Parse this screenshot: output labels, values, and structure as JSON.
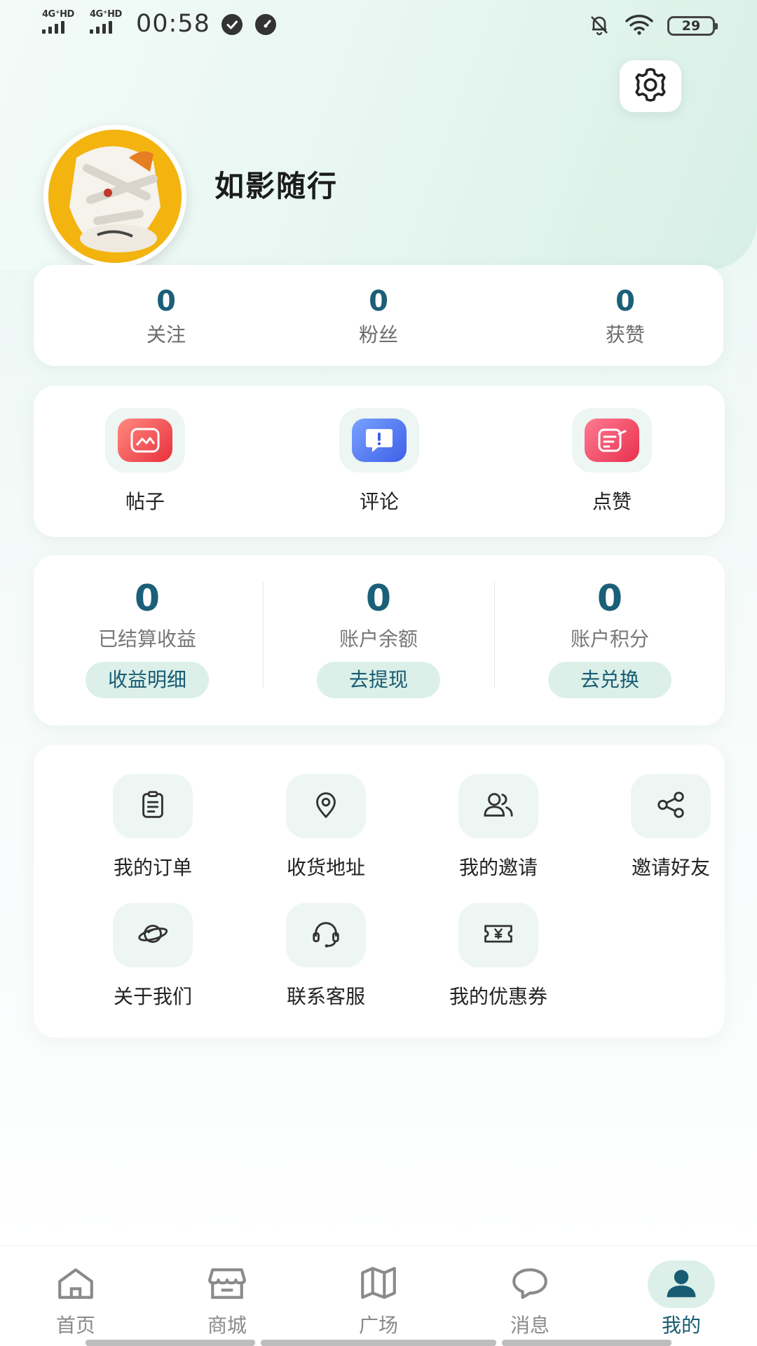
{
  "status_bar": {
    "signal1": "4G⁺HD",
    "signal2": "4G⁺HD",
    "time": "00:58",
    "battery": "29"
  },
  "profile": {
    "username": "如影随行"
  },
  "stats": [
    {
      "value": "0",
      "label": "关注"
    },
    {
      "value": "0",
      "label": "粉丝"
    },
    {
      "value": "0",
      "label": "获赞"
    }
  ],
  "activities": [
    {
      "label": "帖子",
      "icon": "post-icon",
      "color": "#f04f5d"
    },
    {
      "label": "评论",
      "icon": "comment-icon",
      "color": "#4f73f0"
    },
    {
      "label": "点赞",
      "icon": "like-icon",
      "color": "#f04a6a"
    }
  ],
  "finance": [
    {
      "value": "0",
      "label": "已结算收益",
      "action": "收益明细"
    },
    {
      "value": "0",
      "label": "账户余额",
      "action": "去提现"
    },
    {
      "value": "0",
      "label": "账户积分",
      "action": "去兑换"
    }
  ],
  "services": [
    {
      "label": "我的订单",
      "icon": "clipboard-icon"
    },
    {
      "label": "收货地址",
      "icon": "location-pin-icon"
    },
    {
      "label": "我的邀请",
      "icon": "users-icon"
    },
    {
      "label": "邀请好友",
      "icon": "share-icon"
    },
    {
      "label": "关于我们",
      "icon": "planet-icon"
    },
    {
      "label": "联系客服",
      "icon": "headset-icon"
    },
    {
      "label": "我的优惠券",
      "icon": "coupon-icon"
    }
  ],
  "tabbar": [
    {
      "label": "首页",
      "icon": "home-icon"
    },
    {
      "label": "商城",
      "icon": "store-icon"
    },
    {
      "label": "广场",
      "icon": "map-icon"
    },
    {
      "label": "消息",
      "icon": "chat-bubble-icon"
    },
    {
      "label": "我的",
      "icon": "user-icon",
      "active": true
    }
  ],
  "colors": {
    "accent": "#175c72",
    "number": "#1b5f78",
    "pill_bg": "#dcf0e9"
  }
}
